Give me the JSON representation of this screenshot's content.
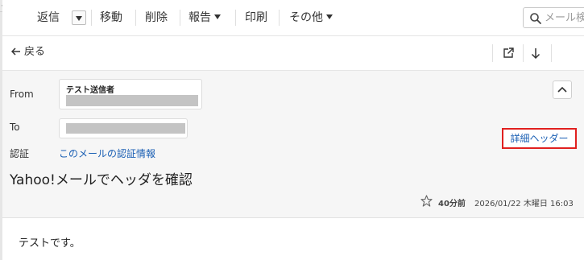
{
  "collapse_glyph": "«",
  "toolbar": {
    "reply_label": "返信",
    "move_label": "移動",
    "delete_label": "削除",
    "report_label": "報告",
    "print_label": "印刷",
    "more_label": "その他",
    "search_placeholder": "メール検"
  },
  "backbar": {
    "back_label": "戻る"
  },
  "header": {
    "from_label": "From",
    "from_name": "テスト送信者",
    "to_label": "To",
    "auth_label": "認証",
    "auth_link": "このメールの認証情報",
    "detail_header": "詳細ヘッダー",
    "subject": "Yahoo!メールでヘッダを確認",
    "relative_time": "40分前",
    "datetime": "2026/01/22 木曜日 16:03"
  },
  "body": {
    "text": "テストです。"
  },
  "colors": {
    "link": "#1a5fb4",
    "highlight_border": "#e0201f",
    "header_bg": "#f6f6f6",
    "redaction": "#c4c4c4"
  },
  "icons": [
    "search-icon",
    "arrow-left-icon",
    "open-external-icon",
    "arrow-down-icon",
    "chevron-up-icon",
    "star-icon",
    "chevron-down-icon"
  ]
}
